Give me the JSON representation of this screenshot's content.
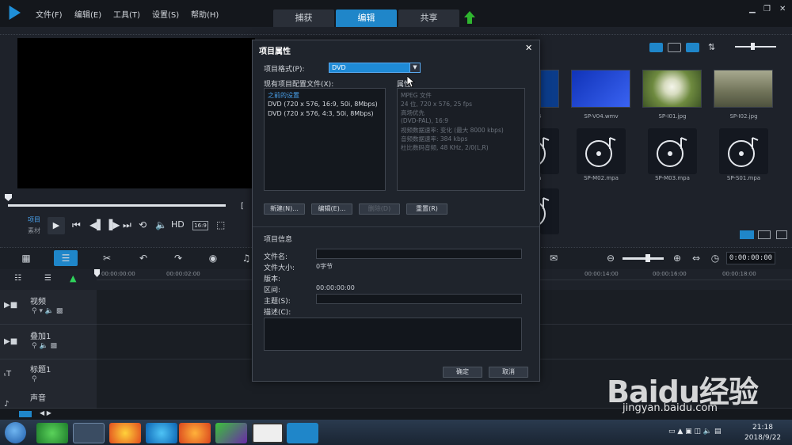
{
  "menubar": {
    "items": [
      "文件(F)",
      "编辑(E)",
      "工具(T)",
      "设置(S)",
      "帮助(H)"
    ],
    "tabs": [
      "捕获",
      "编辑",
      "共享"
    ],
    "active_tab": 1
  },
  "preview": {
    "label_project": "项目",
    "label_clip": "素材",
    "ratio": "16:9",
    "hd": "HD"
  },
  "library": {
    "clips": [
      {
        "label": "p4"
      },
      {
        "label": "SP-V04.wmv"
      },
      {
        "label": "SP-I01.jpg"
      },
      {
        "label": "SP-I02.jpg"
      },
      {
        "label": "pa"
      },
      {
        "label": "SP-M02.mpa"
      },
      {
        "label": "SP-M03.mpa"
      },
      {
        "label": "SP-S01.mpa"
      }
    ]
  },
  "timeline": {
    "timecode": "0:00:00:00",
    "ruler": [
      "00:00:00:00",
      "00:00:02:00",
      "00:00:14:00",
      "00:00:16:00",
      "00:00:18:00"
    ],
    "tracks": [
      {
        "name": "视频"
      },
      {
        "name": "叠加1"
      },
      {
        "name": "标题1"
      },
      {
        "name": "声音"
      }
    ]
  },
  "dialog": {
    "title": "项目属性",
    "format_label": "项目格式(P):",
    "format_value": "DVD",
    "profiles_label": "现有项目配置文件(X):",
    "profiles": [
      "之前的设置",
      "DVD (720 x 576, 16:9, 50i, 8Mbps)",
      "DVD (720 x 576, 4:3, 50i, 8Mbps)"
    ],
    "props_label": "属性",
    "props": [
      "MPEG 文件",
      "24 位, 720 x 576, 25 fps",
      "高场优先",
      "(DVD-PAL), 16:9",
      "视频数据速率: 变化 (最大 8000 kbps)",
      "音频数据速率: 384 kbps",
      "杜比数码音频, 48 KHz, 2/0(L,R)"
    ],
    "buttons": {
      "new": "新建(N)...",
      "edit": "编辑(E)...",
      "delete": "删除(D)",
      "reset": "重置(R)"
    },
    "info_title": "项目信息",
    "fields": {
      "filename": "文件名:",
      "filesize": "文件大小:",
      "filesize_value": "0字节",
      "version": "版本:",
      "duration": "区间:",
      "duration_value": "00:00:00:00",
      "subject": "主题(S):",
      "description": "描述(C):"
    },
    "ok": "确定",
    "cancel": "取消"
  },
  "taskbar": {
    "time": "21:18",
    "date": "2018/9/22"
  },
  "watermark": {
    "logo": "Baidu经验",
    "url": "jingyan.baidu.com"
  },
  "colors": {
    "accent": "#1f86c9",
    "dialog_bg": "#1f242c",
    "panel_bg": "#1e222a"
  }
}
